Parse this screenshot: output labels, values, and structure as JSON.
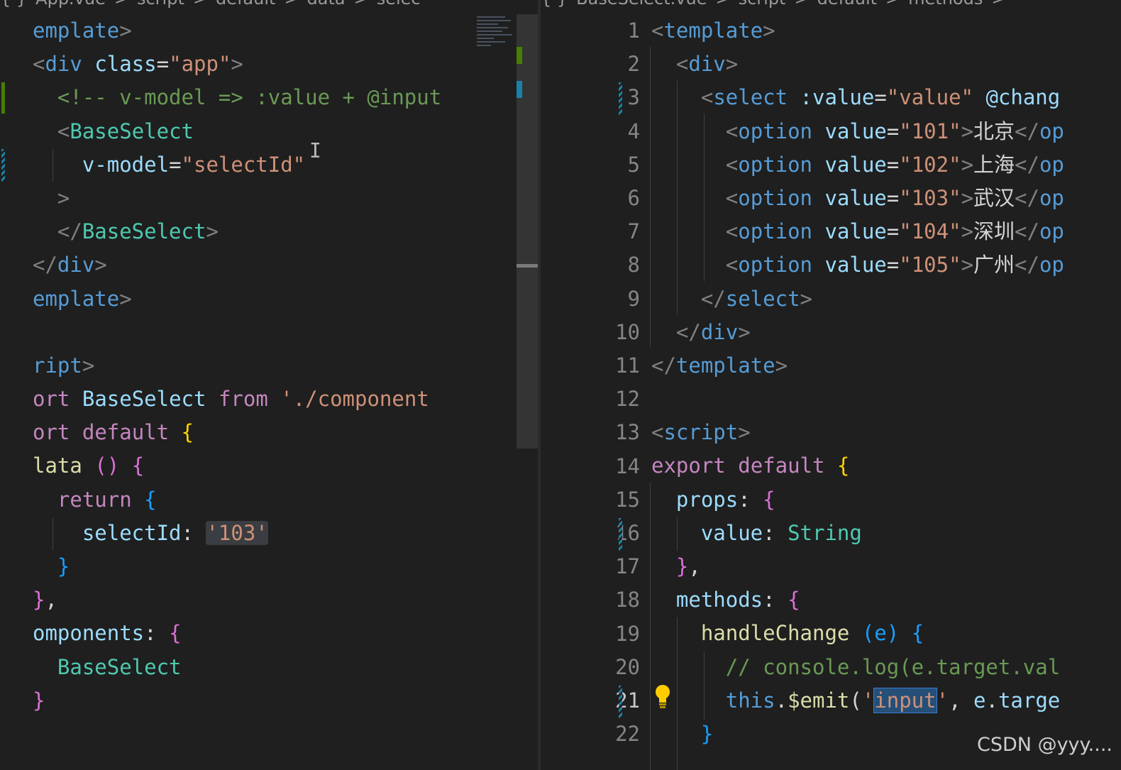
{
  "left_editor": {
    "breadcrumb": [
      "{ }",
      "App.vue",
      ">",
      "script",
      ">",
      "default",
      ">",
      "data",
      ">",
      "selec"
    ],
    "lines": [
      [
        [
          "t-tag",
          "emplate"
        ],
        [
          "t-punc",
          ">"
        ]
      ],
      [
        [
          "t-punc",
          "<"
        ],
        [
          "t-tag",
          "div"
        ],
        [
          "t-plain",
          " "
        ],
        [
          "t-attr",
          "class"
        ],
        [
          "t-plain",
          "="
        ],
        [
          "t-str",
          "\"app\""
        ],
        [
          "t-punc",
          ">"
        ]
      ],
      [
        [
          "t-plain",
          "  "
        ],
        [
          "t-com",
          "<!-- v-model => :value + @input"
        ]
      ],
      [
        [
          "t-plain",
          "  "
        ],
        [
          "t-punc",
          "<"
        ],
        [
          "t-comp",
          "BaseSelect"
        ]
      ],
      [
        [
          "t-plain",
          "    "
        ],
        [
          "t-attr",
          "v-model"
        ],
        [
          "t-plain",
          "="
        ],
        [
          "t-str",
          "\"selectId\""
        ]
      ],
      [
        [
          "t-plain",
          "  "
        ],
        [
          "t-punc",
          ">"
        ]
      ],
      [
        [
          "t-plain",
          "  "
        ],
        [
          "t-punc",
          "</"
        ],
        [
          "t-comp",
          "BaseSelect"
        ],
        [
          "t-punc",
          ">"
        ]
      ],
      [
        [
          "t-punc",
          "</"
        ],
        [
          "t-tag",
          "div"
        ],
        [
          "t-punc",
          ">"
        ]
      ],
      [
        [
          "t-tag",
          "emplate"
        ],
        [
          "t-punc",
          ">"
        ]
      ],
      [
        [
          "t-plain",
          ""
        ]
      ],
      [
        [
          "t-tag",
          "ript"
        ],
        [
          "t-punc",
          ">"
        ]
      ],
      [
        [
          "t-kw",
          "ort"
        ],
        [
          "t-plain",
          " "
        ],
        [
          "t-attr",
          "BaseSelect"
        ],
        [
          "t-plain",
          " "
        ],
        [
          "t-kw",
          "from"
        ],
        [
          "t-plain",
          " "
        ],
        [
          "t-str",
          "'./component"
        ]
      ],
      [
        [
          "t-kw",
          "ort"
        ],
        [
          "t-plain",
          " "
        ],
        [
          "t-kw",
          "default"
        ],
        [
          "t-plain",
          " "
        ],
        [
          "t-b1",
          "{"
        ]
      ],
      [
        [
          "t-fn",
          "lata"
        ],
        [
          "t-plain",
          " "
        ],
        [
          "t-b2",
          "()"
        ],
        [
          "t-plain",
          " "
        ],
        [
          "t-b2",
          "{"
        ]
      ],
      [
        [
          "t-plain",
          "  "
        ],
        [
          "t-kw",
          "return"
        ],
        [
          "t-plain",
          " "
        ],
        [
          "t-b3",
          "{"
        ]
      ],
      [
        [
          "t-plain",
          "    "
        ],
        [
          "t-attr",
          "selectId"
        ],
        [
          "t-plain",
          ": "
        ],
        [
          "t-str hl-box",
          "'103'"
        ]
      ],
      [
        [
          "t-plain",
          "  "
        ],
        [
          "t-b3",
          "}"
        ]
      ],
      [
        [
          "t-b2",
          "}"
        ],
        [
          "t-plain",
          ","
        ]
      ],
      [
        [
          "t-attr",
          "omponents"
        ],
        [
          "t-plain",
          ": "
        ],
        [
          "t-b2",
          "{"
        ]
      ],
      [
        [
          "t-plain",
          "  "
        ],
        [
          "t-comp",
          "BaseSelect"
        ]
      ],
      [
        [
          "t-b2",
          "}"
        ]
      ]
    ]
  },
  "right_editor": {
    "breadcrumb": [
      "{ }",
      "BaseSelect.vue",
      ">",
      "script",
      ">",
      "default",
      ">",
      "methods",
      ">"
    ],
    "line_numbers": [
      "1",
      "2",
      "3",
      "4",
      "5",
      "6",
      "7",
      "8",
      "9",
      "10",
      "11",
      "12",
      "13",
      "14",
      "15",
      "16",
      "17",
      "18",
      "19",
      "20",
      "21",
      "22"
    ],
    "active_line": "21",
    "lines": [
      [
        [
          "t-punc",
          "<"
        ],
        [
          "t-tag",
          "template"
        ],
        [
          "t-punc",
          ">"
        ]
      ],
      [
        [
          "t-plain",
          "  "
        ],
        [
          "t-punc",
          "<"
        ],
        [
          "t-tag",
          "div"
        ],
        [
          "t-punc",
          ">"
        ]
      ],
      [
        [
          "t-plain",
          "    "
        ],
        [
          "t-punc",
          "<"
        ],
        [
          "t-tag",
          "select"
        ],
        [
          "t-plain",
          " "
        ],
        [
          "t-attr",
          ":value"
        ],
        [
          "t-plain",
          "="
        ],
        [
          "t-str",
          "\"value\""
        ],
        [
          "t-plain",
          " "
        ],
        [
          "t-attr",
          "@chang"
        ]
      ],
      [
        [
          "t-plain",
          "      "
        ],
        [
          "t-punc",
          "<"
        ],
        [
          "t-tag",
          "option"
        ],
        [
          "t-plain",
          " "
        ],
        [
          "t-attr",
          "value"
        ],
        [
          "t-plain",
          "="
        ],
        [
          "t-str",
          "\"101\""
        ],
        [
          "t-punc",
          ">"
        ],
        [
          "t-chinese",
          "北京"
        ],
        [
          "t-punc",
          "</"
        ],
        [
          "t-tag",
          "op"
        ]
      ],
      [
        [
          "t-plain",
          "      "
        ],
        [
          "t-punc",
          "<"
        ],
        [
          "t-tag",
          "option"
        ],
        [
          "t-plain",
          " "
        ],
        [
          "t-attr",
          "value"
        ],
        [
          "t-plain",
          "="
        ],
        [
          "t-str",
          "\"102\""
        ],
        [
          "t-punc",
          ">"
        ],
        [
          "t-chinese",
          "上海"
        ],
        [
          "t-punc",
          "</"
        ],
        [
          "t-tag",
          "op"
        ]
      ],
      [
        [
          "t-plain",
          "      "
        ],
        [
          "t-punc",
          "<"
        ],
        [
          "t-tag",
          "option"
        ],
        [
          "t-plain",
          " "
        ],
        [
          "t-attr",
          "value"
        ],
        [
          "t-plain",
          "="
        ],
        [
          "t-str",
          "\"103\""
        ],
        [
          "t-punc",
          ">"
        ],
        [
          "t-chinese",
          "武汉"
        ],
        [
          "t-punc",
          "</"
        ],
        [
          "t-tag",
          "op"
        ]
      ],
      [
        [
          "t-plain",
          "      "
        ],
        [
          "t-punc",
          "<"
        ],
        [
          "t-tag",
          "option"
        ],
        [
          "t-plain",
          " "
        ],
        [
          "t-attr",
          "value"
        ],
        [
          "t-plain",
          "="
        ],
        [
          "t-str",
          "\"104\""
        ],
        [
          "t-punc",
          ">"
        ],
        [
          "t-chinese",
          "深圳"
        ],
        [
          "t-punc",
          "</"
        ],
        [
          "t-tag",
          "op"
        ]
      ],
      [
        [
          "t-plain",
          "      "
        ],
        [
          "t-punc",
          "<"
        ],
        [
          "t-tag",
          "option"
        ],
        [
          "t-plain",
          " "
        ],
        [
          "t-attr",
          "value"
        ],
        [
          "t-plain",
          "="
        ],
        [
          "t-str",
          "\"105\""
        ],
        [
          "t-punc",
          ">"
        ],
        [
          "t-chinese",
          "广州"
        ],
        [
          "t-punc",
          "</"
        ],
        [
          "t-tag",
          "op"
        ]
      ],
      [
        [
          "t-plain",
          "    "
        ],
        [
          "t-punc",
          "</"
        ],
        [
          "t-tag",
          "select"
        ],
        [
          "t-punc",
          ">"
        ]
      ],
      [
        [
          "t-plain",
          "  "
        ],
        [
          "t-punc",
          "</"
        ],
        [
          "t-tag",
          "div"
        ],
        [
          "t-punc",
          ">"
        ]
      ],
      [
        [
          "t-punc",
          "</"
        ],
        [
          "t-tag",
          "template"
        ],
        [
          "t-punc",
          ">"
        ]
      ],
      [
        [
          "t-plain",
          ""
        ]
      ],
      [
        [
          "t-punc",
          "<"
        ],
        [
          "t-tag",
          "script"
        ],
        [
          "t-punc",
          ">"
        ]
      ],
      [
        [
          "t-kw",
          "export"
        ],
        [
          "t-plain",
          " "
        ],
        [
          "t-kw",
          "default"
        ],
        [
          "t-plain",
          " "
        ],
        [
          "t-b1",
          "{"
        ]
      ],
      [
        [
          "t-plain",
          "  "
        ],
        [
          "t-attr",
          "props"
        ],
        [
          "t-plain",
          ": "
        ],
        [
          "t-b2",
          "{"
        ]
      ],
      [
        [
          "t-plain",
          "    "
        ],
        [
          "t-attr",
          "value"
        ],
        [
          "t-plain",
          ": "
        ],
        [
          "t-comp",
          "String"
        ]
      ],
      [
        [
          "t-plain",
          "  "
        ],
        [
          "t-b2",
          "}"
        ],
        [
          "t-plain",
          ","
        ]
      ],
      [
        [
          "t-plain",
          "  "
        ],
        [
          "t-attr",
          "methods"
        ],
        [
          "t-plain",
          ": "
        ],
        [
          "t-b2",
          "{"
        ]
      ],
      [
        [
          "t-plain",
          "    "
        ],
        [
          "t-fn",
          "handleChange"
        ],
        [
          "t-plain",
          " "
        ],
        [
          "t-b3",
          "(e)"
        ],
        [
          "t-plain",
          " "
        ],
        [
          "t-b3",
          "{"
        ]
      ],
      [
        [
          "t-plain",
          "      "
        ],
        [
          "t-com",
          "// console.log(e.target.val"
        ]
      ],
      [
        [
          "t-plain",
          "      "
        ],
        [
          "t-tag",
          "this"
        ],
        [
          "t-plain",
          "."
        ],
        [
          "t-fn",
          "$emit"
        ],
        [
          "t-plain",
          "("
        ],
        [
          "t-str",
          "'"
        ],
        [
          "t-str sel",
          "input"
        ],
        [
          "t-str",
          "'"
        ],
        [
          "t-plain",
          ", "
        ],
        [
          "t-attr",
          "e"
        ],
        [
          "t-plain",
          "."
        ],
        [
          "t-attr",
          "targe"
        ]
      ],
      [
        [
          "t-plain",
          "    "
        ],
        [
          "t-b3",
          "}"
        ]
      ]
    ]
  },
  "watermark": "CSDN @yyy...."
}
